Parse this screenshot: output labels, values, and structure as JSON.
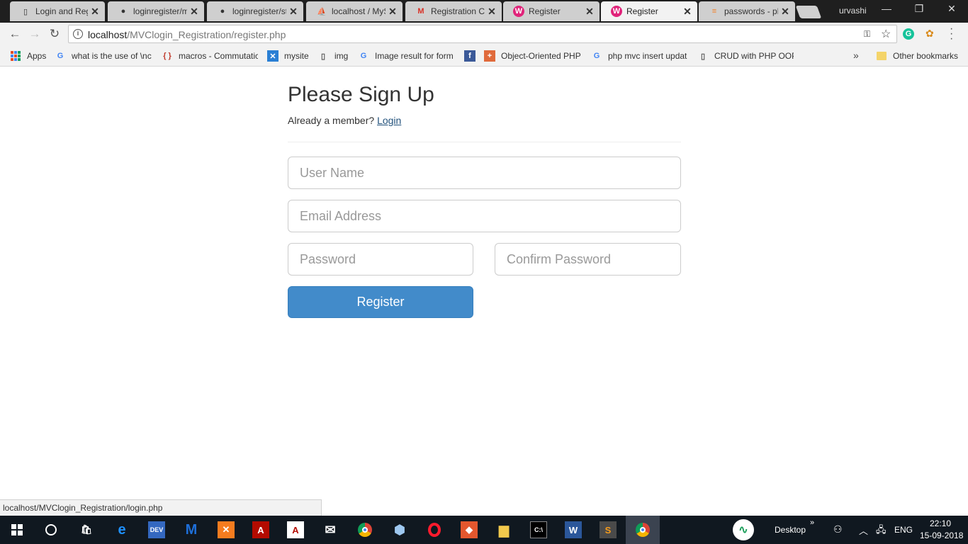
{
  "browser": {
    "tabs": [
      {
        "title": "Login and Reg",
        "favicon": "page-icon"
      },
      {
        "title": "loginregister/m",
        "favicon": "github-icon"
      },
      {
        "title": "loginregister/st",
        "favicon": "github-icon"
      },
      {
        "title": "localhost / MyS",
        "favicon": "phpmyadmin-icon"
      },
      {
        "title": "Registration Co",
        "favicon": "gmail-icon"
      },
      {
        "title": "Register",
        "favicon": "wamp-icon"
      },
      {
        "title": "Register",
        "favicon": "wamp-icon",
        "active": true
      },
      {
        "title": "passwords - ph",
        "favicon": "stackoverflow-icon"
      }
    ],
    "profile_name": "urvashi",
    "url_host": "localhost",
    "url_path": "/MVClogin_Registration/register.php",
    "bookmarks": [
      {
        "label": "Apps",
        "icon": "apps-grid-icon"
      },
      {
        "label": "what is the use of \\nc",
        "icon": "google-icon"
      },
      {
        "label": "macros - Commutatic",
        "icon": "braces-icon"
      },
      {
        "label": "mysite",
        "icon": "xampp-icon"
      },
      {
        "label": "img",
        "icon": "page-icon"
      },
      {
        "label": "Image result for form",
        "icon": "google-icon"
      },
      {
        "label": "",
        "icon": "facebook-icon"
      },
      {
        "label": "Object-Oriented PHP",
        "icon": "plus-icon"
      },
      {
        "label": "php mvc insert updat",
        "icon": "google-icon"
      },
      {
        "label": "CRUD with PHP OOP",
        "icon": "page-icon"
      }
    ],
    "other_bookmarks": "Other bookmarks",
    "status_url": "localhost/MVClogin_Registration/login.php"
  },
  "page": {
    "title": "Please Sign Up",
    "member_text": "Already a member?",
    "login_link": "Login",
    "fields": {
      "username_placeholder": "User Name",
      "email_placeholder": "Email Address",
      "password_placeholder": "Password",
      "confirm_placeholder": "Confirm Password"
    },
    "register_label": "Register",
    "accent_color": "#428bca"
  },
  "taskbar": {
    "desktop_label": "Desktop",
    "language": "ENG",
    "time": "22:10",
    "date": "15-09-2018"
  }
}
